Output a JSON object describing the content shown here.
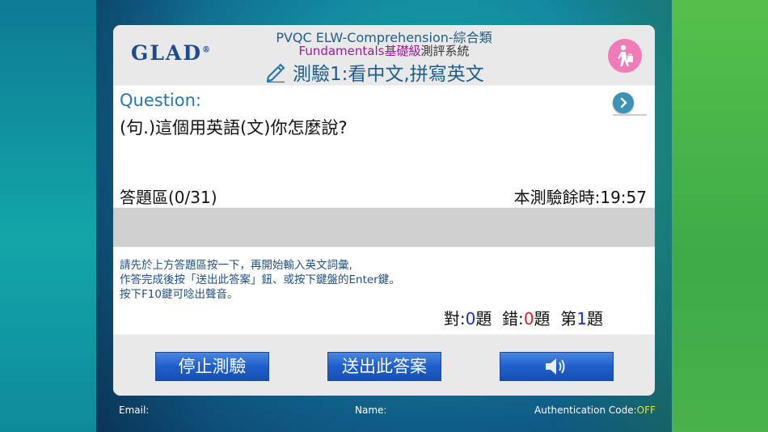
{
  "header": {
    "logo": "GLAD",
    "title_line1": "PVQC ELW-Comprehension-綜合類",
    "title_line2_highlight": "Fundamentals基礎級",
    "title_line2_rest": "測評系統",
    "title_line3": "測驗1:看中文,拼寫英文",
    "icons": {
      "edit": "pencil-icon",
      "user": "walking-person-icon"
    }
  },
  "question": {
    "label": "Question:",
    "text": "(句.)這個用英語(文)你怎麼說?",
    "next_icon": "chevron-right-icon"
  },
  "answer": {
    "label": "答題區(0/31)",
    "timer": "本測驗餘時:19:57",
    "input_value": ""
  },
  "instructions": {
    "line1": "請先於上方答題區按一下，再開始輸入英文詞彙,",
    "line2": "作答完成後按「送出此答案」鈕、或按下鍵盤的Enter鍵。",
    "line3": "按下F10鍵可唸出聲音。"
  },
  "score": {
    "correct_label": "對:",
    "correct_value": "0",
    "correct_unit": "題",
    "wrong_label": "錯:",
    "wrong_value": "0",
    "wrong_unit": "題",
    "current_label": "第",
    "current_value": "1",
    "current_unit": "題"
  },
  "buttons": {
    "stop": "停止測驗",
    "submit": "送出此答案",
    "sound_icon": "speaker-icon"
  },
  "footer": {
    "email_label": "Email:",
    "name_label": "Name:",
    "auth_label": "Authentication Code:",
    "auth_value": "OFF"
  },
  "colors": {
    "accent_blue": "#1f5e8a",
    "button_blue": "#1f5fcc",
    "magenta": "#a0189a",
    "avatar_pink": "#f07bb7",
    "auth_yellow": "#f2e21a"
  }
}
